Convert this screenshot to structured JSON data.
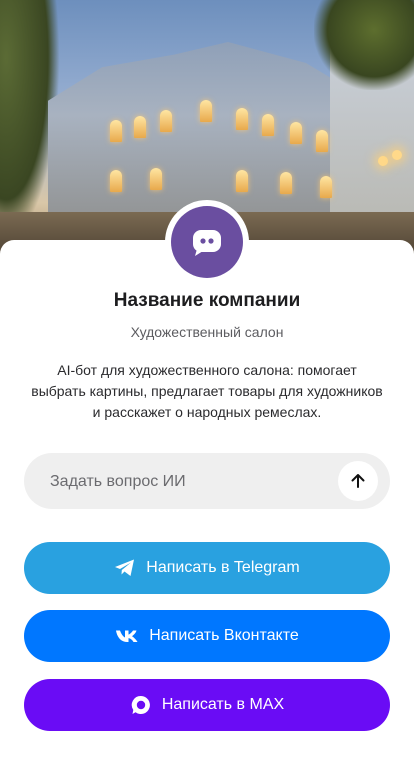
{
  "colors": {
    "avatar_bg": "#6a4ea0",
    "telegram": "#29a1e0",
    "vkontakte": "#0077ff",
    "max": "#6a0cf5",
    "input_bg": "#efefef"
  },
  "hero": {
    "image": "illuminated-classical-building-street"
  },
  "profile": {
    "avatar_icon": "chat-bubble-icon",
    "company_name": "Название компании",
    "category": "Художественный салон",
    "description": "AI-бот для художественного салона: помогает выбрать картины, предлагает товары для художников и расскажет о народных ремеслах."
  },
  "ask": {
    "placeholder": "Задать вопрос ИИ",
    "send_icon": "arrow-up-icon"
  },
  "buttons": {
    "telegram": {
      "label": "Написать в Telegram",
      "icon": "telegram-plane-icon"
    },
    "vk": {
      "label": "Написать Вконтакте",
      "icon": "vk-logo-icon"
    },
    "max": {
      "label": "Написать в MAX",
      "icon": "max-logo-icon"
    }
  }
}
